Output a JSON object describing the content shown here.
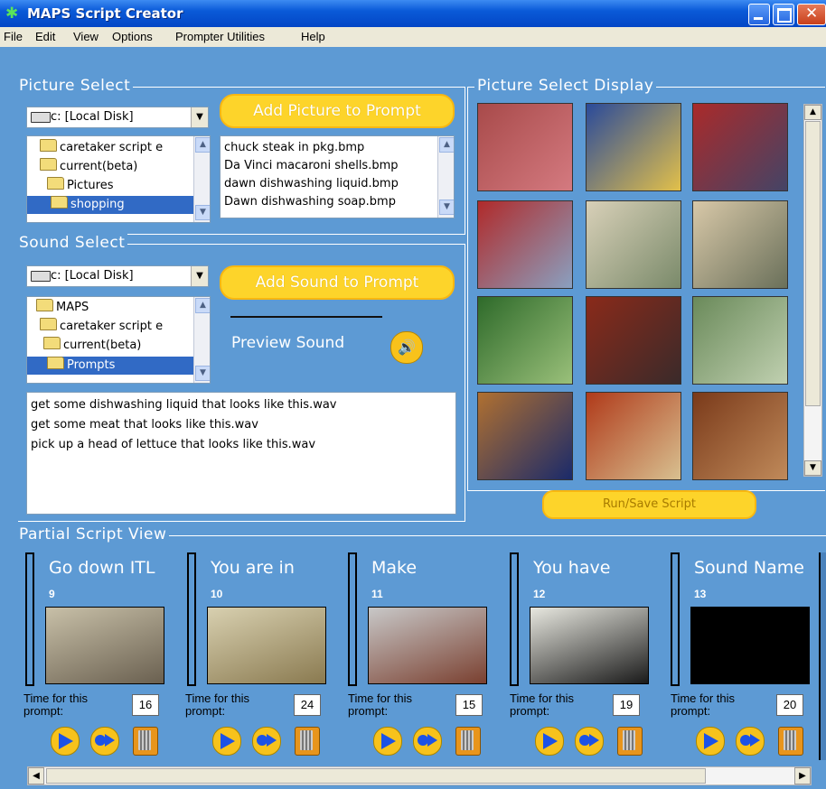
{
  "window": {
    "title": "MAPS Script Creator"
  },
  "menu": [
    "File",
    "Edit",
    "View",
    "Options",
    "Prompter Utilities",
    "Help"
  ],
  "picture_select": {
    "legend": "Picture Select",
    "drive": "c: [Local Disk]",
    "folders": [
      "caretaker script e",
      "current(beta)",
      "Pictures",
      "shopping"
    ],
    "selected_folder": "shopping",
    "add_button": "Add Picture to Prompt",
    "files": [
      "chuck steak in pkg.bmp",
      "Da Vinci macaroni shells.bmp",
      "dawn dishwashing liquid.bmp",
      "Dawn dishwashing soap.bmp"
    ]
  },
  "sound_select": {
    "legend": "Sound Select",
    "drive": "c: [Local Disk]",
    "folders": [
      "MAPS",
      "caretaker script e",
      "current(beta)",
      "Prompts"
    ],
    "selected_folder": "Prompts",
    "add_button": "Add Sound to Prompt",
    "preview_label": "Preview Sound",
    "files": [
      "get some dishwashing liquid that looks like this.wav",
      "get some meat that looks like this.wav",
      "pick up a head of lettuce that looks like this.wav"
    ]
  },
  "picture_display": {
    "legend": "Picture Select Display",
    "thumbnails": [
      {
        "name": "meat-package",
        "colors": [
          "#a84a4a",
          "#d47a80"
        ]
      },
      {
        "name": "pasta-boxes",
        "colors": [
          "#2a4a9a",
          "#e2c04a"
        ]
      },
      {
        "name": "dish-soap-bottles",
        "colors": [
          "#aa2a2a",
          "#444466"
        ]
      },
      {
        "name": "dawn-bottles-shelf",
        "colors": [
          "#b02a2a",
          "#8aa0c0"
        ]
      },
      {
        "name": "dollar-bill",
        "colors": [
          "#d8d0b8",
          "#7a8a6a"
        ]
      },
      {
        "name": "five-dollar-bill",
        "colors": [
          "#d8c8a8",
          "#6a705a"
        ]
      },
      {
        "name": "green-peppers",
        "colors": [
          "#2e6a2a",
          "#9ac07a"
        ]
      },
      {
        "name": "sauce-jars-shelf",
        "colors": [
          "#8a2a1a",
          "#3a2a2a"
        ]
      },
      {
        "name": "cabbage",
        "colors": [
          "#6a8a5a",
          "#c0d0b0"
        ]
      },
      {
        "name": "toy-on-carpet",
        "colors": [
          "#b07030",
          "#1a2a6a"
        ]
      },
      {
        "name": "prego-jars",
        "colors": [
          "#b03a1a",
          "#d8c090"
        ]
      },
      {
        "name": "leather-purse",
        "colors": [
          "#7a3a1a",
          "#c08a5a"
        ]
      }
    ]
  },
  "run_save_button": "Run/Save Script",
  "partial_script": {
    "legend": "Partial Script View",
    "time_label_line1": "Time for this",
    "time_label_line2": "prompt:",
    "cards": [
      {
        "title": "Go down ITL",
        "number": "9",
        "time": "16",
        "image": "hallway-photo",
        "colors": [
          "#c8c0a8",
          "#6a6050"
        ]
      },
      {
        "title": "You are in",
        "number": "10",
        "time": "24",
        "image": "glass-doors-photo",
        "colors": [
          "#d8d0b0",
          "#8a7a50"
        ]
      },
      {
        "title": "Make",
        "number": "11",
        "time": "15",
        "image": "corridor-doors-photo",
        "colors": [
          "#c8c8c8",
          "#7a4030"
        ]
      },
      {
        "title": "You have",
        "number": "12",
        "time": "19",
        "image": "room-sign-photo",
        "colors": [
          "#e8e8e0",
          "#1a1a1a"
        ]
      },
      {
        "title": "Sound Name",
        "number": "13",
        "time": "20",
        "image": "blank-image",
        "colors": [
          "#000000",
          "#000000"
        ]
      }
    ]
  }
}
